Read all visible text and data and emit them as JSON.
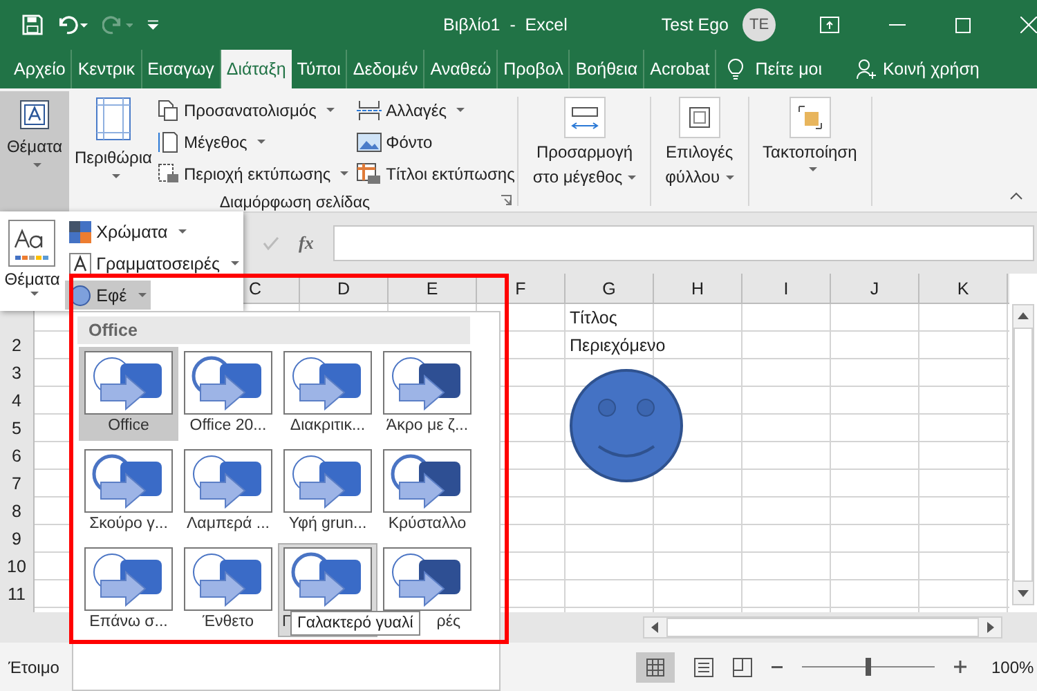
{
  "title_bar": {
    "title": "Βιβλίο1  -  Excel",
    "user": "Test Ego",
    "avatar_initials": "TE"
  },
  "tabs": [
    {
      "label": "Αρχείο",
      "selected": false
    },
    {
      "label": "Κεντρικ",
      "selected": false
    },
    {
      "label": "Εισαγωγ",
      "selected": false
    },
    {
      "label": "Διάταξη",
      "selected": true
    },
    {
      "label": "Τύποι",
      "selected": false
    },
    {
      "label": "Δεδομέν",
      "selected": false
    },
    {
      "label": "Αναθεώ",
      "selected": false
    },
    {
      "label": "Προβολ",
      "selected": false
    },
    {
      "label": "Βοήθεια",
      "selected": false
    },
    {
      "label": "Acrobat",
      "selected": false
    }
  ],
  "tell_me": "Πείτε μοι",
  "share": "Κοινή χρήση",
  "ribbon": {
    "themes_button": {
      "label": "Θέματα",
      "selected": true
    },
    "margins_button": {
      "label": "Περιθώρια"
    },
    "small_buttons": [
      {
        "kind": "orientation",
        "label": "Προσανατολισμός",
        "dropdown": true
      },
      {
        "kind": "size",
        "label": "Μέγεθος",
        "dropdown": true
      },
      {
        "kind": "print-area",
        "label": "Περιοχή εκτύπωσης",
        "dropdown": true
      },
      {
        "kind": "breaks",
        "label": "Αλλαγές",
        "dropdown": true
      },
      {
        "kind": "background",
        "label": "Φόντο",
        "dropdown": false
      },
      {
        "kind": "print-titles",
        "label": "Τίτλοι εκτύπωσης",
        "dropdown": false
      }
    ],
    "group_label": "Διαμόρφωση σελίδας",
    "big_buttons": [
      {
        "kind": "scale",
        "lines": [
          "Προσαρμογή",
          "στο μέγεθος"
        ]
      },
      {
        "kind": "sheet-options",
        "lines": [
          "Επιλογές",
          "φύλλου"
        ]
      },
      {
        "kind": "arrange",
        "lines": [
          "Τακτοποίηση"
        ]
      }
    ]
  },
  "formula_bar": {
    "function_label": "fx"
  },
  "sheet": {
    "columns": [
      "C",
      "D",
      "E",
      "F",
      "G",
      "H",
      "I",
      "J",
      "K"
    ],
    "rows": [
      {
        "cell_g": "Τίτλος"
      },
      {
        "number": "2",
        "cell_g": "Περιεχόμενο"
      },
      {
        "number": "3"
      },
      {
        "number": "4"
      },
      {
        "number": "5"
      },
      {
        "number": "6"
      },
      {
        "number": "7"
      },
      {
        "number": "8"
      },
      {
        "number": "9"
      },
      {
        "number": "10"
      },
      {
        "number": "11"
      }
    ]
  },
  "themes_menu": {
    "button_label": "Θέματα",
    "items": [
      {
        "kind": "colors",
        "label": "Χρώματα",
        "selected": false
      },
      {
        "kind": "fonts",
        "label": "Γραμματοσειρές",
        "selected": false
      },
      {
        "kind": "effects",
        "label": "Εφέ",
        "selected": true
      }
    ]
  },
  "effects_gallery": {
    "header": "Office",
    "tooltip": "Γαλακτερό γυαλί",
    "items": [
      {
        "label": "Office",
        "selected": true,
        "hovered": false
      },
      {
        "label": "Office 20...",
        "selected": false,
        "hovered": false
      },
      {
        "label": "Διακριτικ...",
        "selected": false,
        "hovered": false
      },
      {
        "label": "Άκρο με ζ...",
        "selected": false,
        "hovered": false
      },
      {
        "label": "Σκούρο γ...",
        "selected": false,
        "hovered": false
      },
      {
        "label": "Λαμπερά ...",
        "selected": false,
        "hovered": false
      },
      {
        "label": "Υφή grun...",
        "selected": false,
        "hovered": false
      },
      {
        "label": "Κρύσταλλο",
        "selected": false,
        "hovered": false
      },
      {
        "label": "Επάνω σ...",
        "selected": false,
        "hovered": false
      },
      {
        "label": "Ένθετο",
        "selected": false,
        "hovered": false
      },
      {
        "label": "Γ",
        "selected": false,
        "hovered": true
      },
      {
        "label": "ρές",
        "selected": false,
        "hovered": false
      }
    ]
  },
  "status_bar": {
    "text": "Έτοιμο",
    "zoom_label": "100%",
    "zoom": {
      "level": 0.5
    }
  }
}
